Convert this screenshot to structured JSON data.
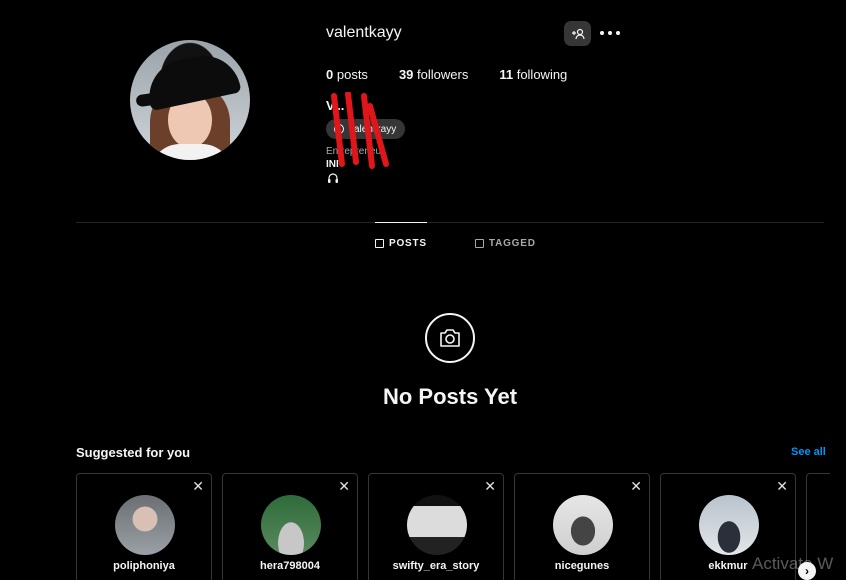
{
  "profile": {
    "username": "valentkayy",
    "posts_count": "0",
    "posts_label": "posts",
    "followers_count": "39",
    "followers_label": "followers",
    "following_count": "11",
    "following_label": "following",
    "full_name": "V... I",
    "threads_handle": "valentkayy",
    "category": "Entrepreneur",
    "bio_line": "INI"
  },
  "tabs": [
    {
      "label": "POSTS",
      "icon": "grid-icon",
      "active": true
    },
    {
      "label": "TAGGED",
      "icon": "tag-icon",
      "active": false
    }
  ],
  "empty_state": {
    "title": "No Posts Yet",
    "icon": "camera-icon"
  },
  "suggested": {
    "title": "Suggested for you",
    "see_all": "See all",
    "cards": [
      {
        "username": "poliphoniya",
        "sub": "",
        "colors": [
          "#6b6f73",
          "#d9c0b5"
        ]
      },
      {
        "username": "hera798004",
        "sub": "",
        "colors": [
          "#2e6b3a",
          "#c7c7c7"
        ]
      },
      {
        "username": "swifty_era_story",
        "sub": "",
        "colors": [
          "#dcdcdc",
          "#111111"
        ]
      },
      {
        "username": "nicegunes",
        "sub": "",
        "colors": [
          "#d9d9d9",
          "#444444"
        ]
      },
      {
        "username": "ekkmur",
        "sub": "",
        "colors": [
          "#b9c2cc",
          "#2a2f3a"
        ]
      }
    ]
  },
  "overlay": {
    "watermark": "Activate W"
  },
  "colors": {
    "accent": "#0095f6",
    "background": "#000000",
    "annotation": "#e0161b"
  }
}
